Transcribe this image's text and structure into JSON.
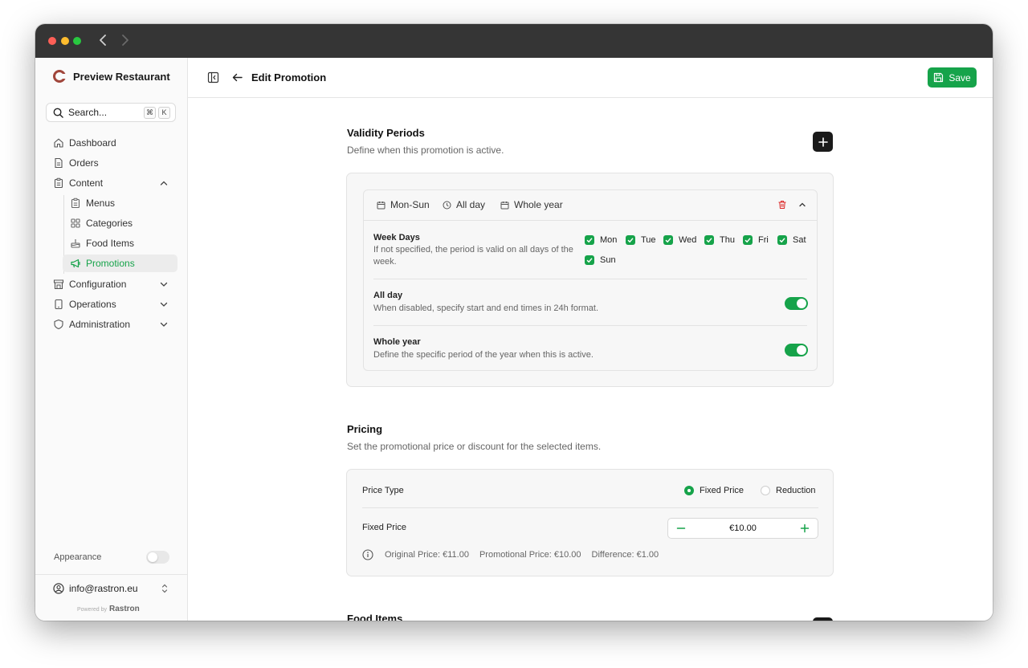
{
  "sidebar": {
    "brand": "Preview Restaurant",
    "search": {
      "placeholder": "Search...",
      "shortcut": [
        "⌘",
        "K"
      ]
    },
    "items": [
      {
        "label": "Dashboard"
      },
      {
        "label": "Orders"
      },
      {
        "label": "Content"
      },
      {
        "label": "Menus"
      },
      {
        "label": "Categories"
      },
      {
        "label": "Food Items"
      },
      {
        "label": "Promotions"
      },
      {
        "label": "Configuration"
      },
      {
        "label": "Operations"
      },
      {
        "label": "Administration"
      }
    ],
    "appearance_label": "Appearance",
    "user_email": "info@rastron.eu",
    "powered_by": "Powered by",
    "powered_brand": "Rastron"
  },
  "header": {
    "title": "Edit Promotion",
    "save_label": "Save"
  },
  "validity": {
    "title": "Validity Periods",
    "description": "Define when this promotion is active.",
    "period": {
      "days_chip": "Mon-Sun",
      "time_chip": "All day",
      "year_chip": "Whole year",
      "week_days_title": "Week Days",
      "week_days_desc": "If not specified, the period is valid on all days of the week.",
      "days": [
        "Mon",
        "Tue",
        "Wed",
        "Thu",
        "Fri",
        "Sat",
        "Sun"
      ],
      "all_day_title": "All day",
      "all_day_desc": "When disabled, specify start and end times in 24h format.",
      "whole_year_title": "Whole year",
      "whole_year_desc": "Define the specific period of the year when this is active."
    }
  },
  "pricing": {
    "title": "Pricing",
    "description": "Set the promotional price or discount for the selected items.",
    "price_type_label": "Price Type",
    "options": [
      "Fixed Price",
      "Reduction"
    ],
    "selected": "Fixed Price",
    "fixed_price_label": "Fixed Price",
    "fixed_price_value": "€10.00",
    "original": "Original Price: €11.00",
    "promotional": "Promotional Price: €10.00",
    "difference": "Difference: €1.00"
  },
  "food_items": {
    "title": "Food Items"
  },
  "colors": {
    "accent": "#16a34a",
    "danger": "#dc2626",
    "titlebar": "#353535"
  }
}
